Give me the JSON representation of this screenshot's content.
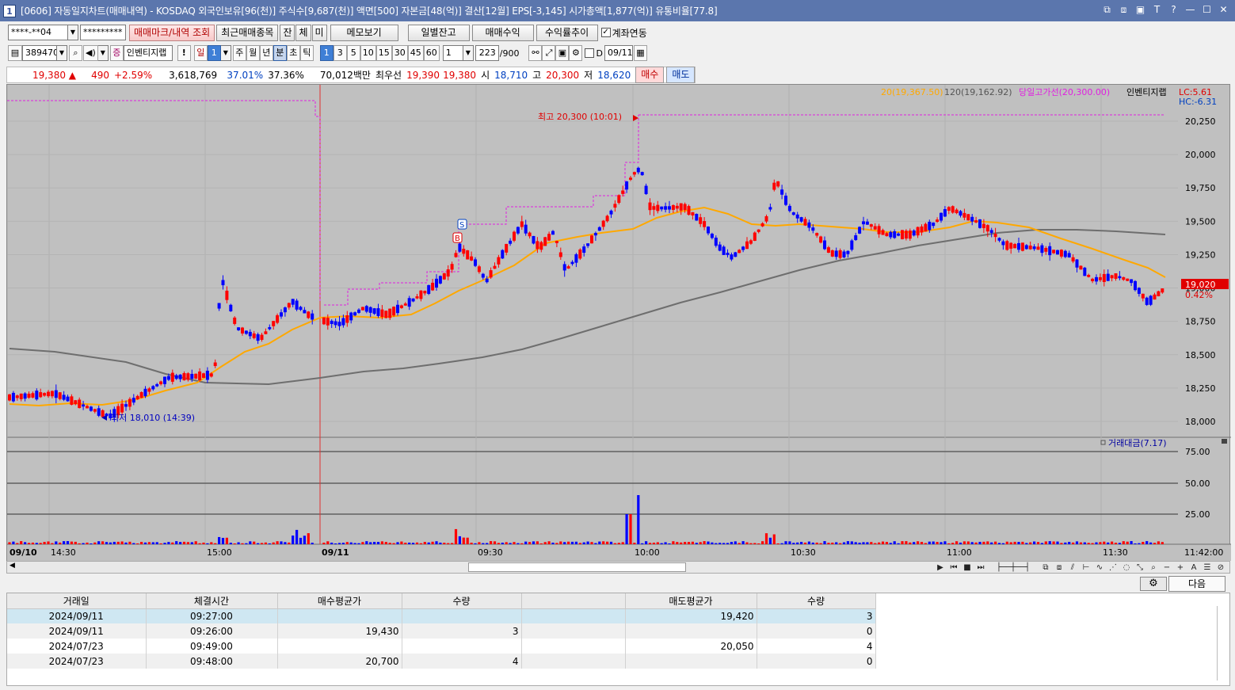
{
  "title": {
    "num": "1",
    "text": "[0606] 자동일지차트(매매내역) - KOSDAQ 외국인보유[96(천)] 주식수[9,687(천)] 액면[500] 자본금[48(억)] 결산[12월] EPS[-3,145] 시가총액[1,877(억)] 유통비율[77.8]"
  },
  "window_buttons": [
    "⧉",
    "⧈",
    "▣",
    "T",
    "?",
    "—",
    "☐",
    "✕"
  ],
  "toolbar1": {
    "account": "****-**04",
    "password": "*********",
    "btn_mark": "매매마크/내역 조회",
    "btn_recent": "최근매매종목",
    "btn_jan": "잔",
    "btn_che": "체",
    "btn_mi": "미",
    "btn_memo": "메모보기",
    "btn_daily": "일별잔고",
    "btn_profit": "매매수익",
    "btn_return": "수익률추이",
    "link_label": "계좌연동",
    "link_checked": "✓"
  },
  "toolbar2": {
    "code": "389470",
    "stock_name": "인벤티지랩",
    "periods": [
      "일",
      "주",
      "월",
      "년",
      "분",
      "초",
      "틱"
    ],
    "day_value": "1",
    "minutes": [
      "1",
      "3",
      "5",
      "10",
      "15",
      "30",
      "45",
      "60"
    ],
    "unit_value": "1",
    "count": "223",
    "count_total": "/900",
    "d_label": "D",
    "date": "09/11"
  },
  "quote": {
    "price": "19,380 ▲",
    "change": "490",
    "pct": "+2.59%",
    "volume": "3,618,769",
    "ratio1": "37.01%",
    "ratio2": "37.36%",
    "amount": "70,012백만",
    "best_label": "최우선",
    "ask": "19,390",
    "bid": "19,380",
    "open_label": "시",
    "open": "18,710",
    "high_label": "고",
    "high": "20,300",
    "low_label": "저",
    "low": "18,620",
    "buy_btn": "매수",
    "sell_btn": "매도"
  },
  "chart": {
    "legend_ma20": "20(19,367.50)",
    "legend_ma120": "120(19,162.92)",
    "legend_high_line": "당일고가선(20,300.00)",
    "legend_name": "인벤티지랩",
    "lc": "LC:5.61",
    "hc": "HC:-6.31",
    "y_labels": [
      "20,250",
      "20,000",
      "19,750",
      "19,500",
      "19,250",
      "19,000",
      "18,750",
      "18,500",
      "18,250",
      "18,000"
    ],
    "high_anno": "최고 20,300 (10:01)",
    "low_anno": "최저 18,010 (14:39)",
    "last_price": "19,020",
    "last_pct": "0.42%",
    "vol_legend": "거래대금(7.17)",
    "vol_labels": [
      "75.00",
      "50.00",
      "25.00"
    ],
    "x_labels": [
      "09/10",
      "14:30",
      "15:00",
      "09/11",
      "09:30",
      "10:00",
      "10:30",
      "11:00",
      "11:30",
      "11:42:00"
    ],
    "mark_buy": "B",
    "mark_sell": "S",
    "colors": {
      "up": "#ff0000",
      "down": "#0000ff",
      "ma20": "#ffa800",
      "ma120": "#6e6e6e",
      "high_line": "#e020e0",
      "bg": "#c0c0c0"
    }
  },
  "bottom": {
    "next_btn": "다음",
    "gear": "⚙"
  },
  "table": {
    "headers": [
      "거래일",
      "체결시간",
      "매수평균가",
      "수량",
      "",
      "매도평균가",
      "수량"
    ],
    "rows": [
      [
        "2024/09/11",
        "09:27:00",
        "",
        "",
        "",
        "19,420",
        "3"
      ],
      [
        "2024/09/11",
        "09:26:00",
        "19,430",
        "3",
        "",
        "",
        "0"
      ],
      [
        "2024/07/23",
        "09:49:00",
        "",
        "",
        "",
        "20,050",
        "4"
      ],
      [
        "2024/07/23",
        "09:48:00",
        "20,700",
        "4",
        "",
        "",
        "0"
      ]
    ]
  }
}
